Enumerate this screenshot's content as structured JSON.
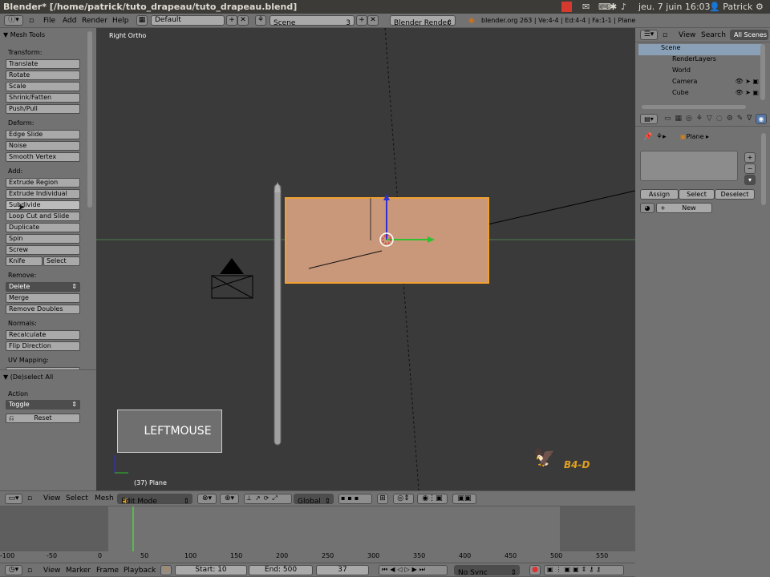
{
  "system_bar": {
    "window_title": "Blender* [/home/patrick/tuto_drapeau/tuto_drapeau.blend]",
    "clock": "jeu. 7 juin 16:03",
    "user": "Patrick"
  },
  "info_header": {
    "menu": [
      "File",
      "Add",
      "Render",
      "Help"
    ],
    "screen_layout": "Default",
    "scene": "Scene",
    "scene_users": "3",
    "render_engine": "Blender Render",
    "stats": "blender.org 263 | Ve:4-4 | Ed:4-4 | Fa:1-1 | Plane"
  },
  "tool_panel": {
    "title": "Mesh Tools",
    "sections": {
      "transform": {
        "label": "Transform:",
        "items": [
          "Translate",
          "Rotate",
          "Scale",
          "Shrink/Fatten",
          "Push/Pull"
        ]
      },
      "deform": {
        "label": "Deform:",
        "items": [
          "Edge Slide",
          "Noise",
          "Smooth Vertex"
        ]
      },
      "add": {
        "label": "Add:",
        "items": [
          "Extrude Region",
          "Extrude Individual",
          "Subdivide",
          "Loop Cut and Slide",
          "Duplicate",
          "Spin",
          "Screw"
        ],
        "knife": "Knife",
        "select": "Select"
      },
      "remove": {
        "label": "Remove:",
        "delete": "Delete",
        "items": [
          "Merge",
          "Remove Doubles"
        ]
      },
      "normals": {
        "label": "Normals:",
        "items": [
          "Recalculate",
          "Flip Direction"
        ]
      },
      "uv": {
        "label": "UV Mapping:"
      }
    },
    "operator": {
      "title": "(De)select All",
      "action_label": "Action",
      "action_value": "Toggle",
      "reset": "Reset"
    }
  },
  "viewport": {
    "view_name": "Right Ortho",
    "object_info": "(37) Plane",
    "key_overlay": "LEFTMOUSE",
    "logo_text": "B4-D",
    "header": {
      "menu": [
        "View",
        "Select",
        "Mesh"
      ],
      "mode": "Edit Mode",
      "orientation": "Global"
    }
  },
  "outliner": {
    "menu": [
      "View",
      "Search"
    ],
    "filter": "All Scenes",
    "items": [
      "Scene",
      "RenderLayers",
      "World",
      "Camera",
      "Cube"
    ]
  },
  "properties": {
    "object_name": "Plane",
    "assign": "Assign",
    "select": "Select",
    "deselect": "Deselect",
    "new": "New"
  },
  "timeline": {
    "ruler": [
      "-100",
      "-50",
      "0",
      "50",
      "100",
      "150",
      "200",
      "250",
      "300",
      "350",
      "400",
      "450",
      "500",
      "550"
    ],
    "menu": [
      "View",
      "Marker",
      "Frame",
      "Playback"
    ],
    "start": "Start: 10",
    "end": "End: 500",
    "current": "37",
    "sync": "No Sync"
  },
  "colors": {
    "viewport_bg": "#3a3a3a",
    "panel_bg": "#727272",
    "selected_face": "#c9977a",
    "selected_edge": "#f0a030",
    "system_bar": "#3c3b37"
  }
}
